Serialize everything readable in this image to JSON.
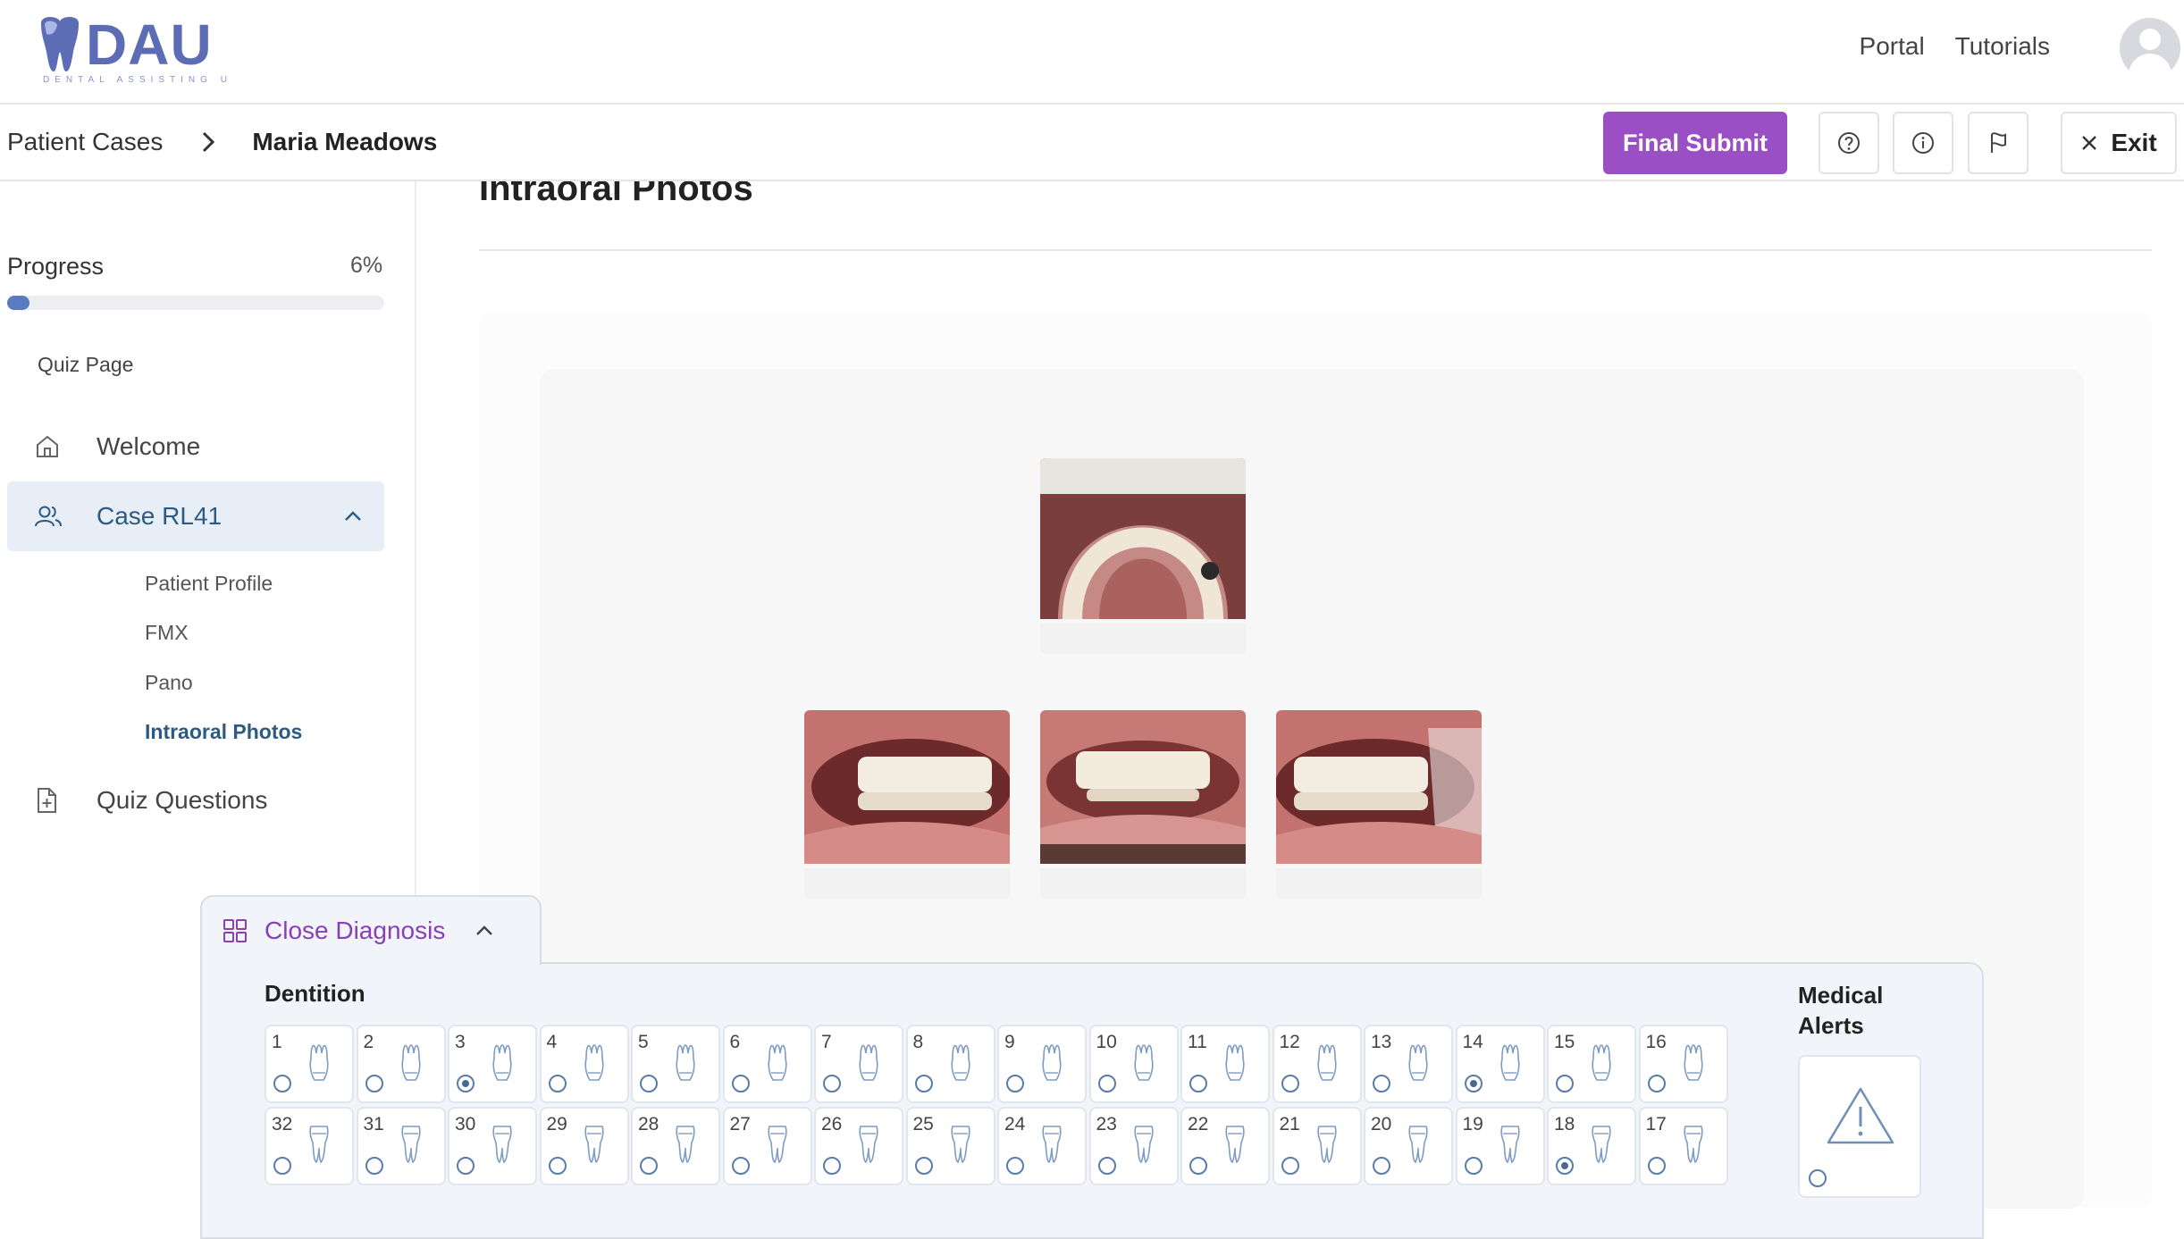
{
  "app": {
    "logo_text": "DAU",
    "logo_subtitle": "DENTAL ASSISTING U"
  },
  "topnav": {
    "portal": "Portal",
    "tutorials": "Tutorials"
  },
  "breadcrumb": {
    "root": "Patient Cases",
    "current": "Maria Meadows"
  },
  "toolbar": {
    "final_submit": "Final Submit",
    "exit": "Exit"
  },
  "sidebar": {
    "progress_label": "Progress",
    "progress_value": "6%",
    "progress_fraction": 0.06,
    "section_label": "Quiz Page",
    "items": [
      {
        "label": "Welcome",
        "icon": "home-icon"
      },
      {
        "label": "Case RL41",
        "icon": "users-icon",
        "expanded": true
      },
      {
        "label": "Quiz Questions",
        "icon": "file-plus-icon"
      }
    ],
    "sub_items": [
      {
        "label": "Patient Profile"
      },
      {
        "label": "FMX"
      },
      {
        "label": "Pano"
      },
      {
        "label": "Intraoral Photos",
        "active": true
      }
    ]
  },
  "main": {
    "title": "Intraoral Photos"
  },
  "diagnosis": {
    "toggle_label": "Close Diagnosis",
    "dentition_title": "Dentition",
    "medical_alerts_title": "Medical Alerts",
    "upper_teeth": [
      {
        "n": "1",
        "selected": false
      },
      {
        "n": "2",
        "selected": false
      },
      {
        "n": "3",
        "selected": true
      },
      {
        "n": "4",
        "selected": false
      },
      {
        "n": "5",
        "selected": false
      },
      {
        "n": "6",
        "selected": false
      },
      {
        "n": "7",
        "selected": false
      },
      {
        "n": "8",
        "selected": false
      },
      {
        "n": "9",
        "selected": false
      },
      {
        "n": "10",
        "selected": false
      },
      {
        "n": "11",
        "selected": false
      },
      {
        "n": "12",
        "selected": false
      },
      {
        "n": "13",
        "selected": false
      },
      {
        "n": "14",
        "selected": true
      },
      {
        "n": "15",
        "selected": false
      },
      {
        "n": "16",
        "selected": false
      }
    ],
    "lower_teeth": [
      {
        "n": "32",
        "selected": false
      },
      {
        "n": "31",
        "selected": false
      },
      {
        "n": "30",
        "selected": false
      },
      {
        "n": "29",
        "selected": false
      },
      {
        "n": "28",
        "selected": false
      },
      {
        "n": "27",
        "selected": false
      },
      {
        "n": "26",
        "selected": false
      },
      {
        "n": "25",
        "selected": false
      },
      {
        "n": "24",
        "selected": false
      },
      {
        "n": "23",
        "selected": false
      },
      {
        "n": "22",
        "selected": false
      },
      {
        "n": "21",
        "selected": false
      },
      {
        "n": "20",
        "selected": false
      },
      {
        "n": "19",
        "selected": false
      },
      {
        "n": "18",
        "selected": true
      },
      {
        "n": "17",
        "selected": false
      }
    ]
  },
  "colors": {
    "accent": "#9b4fc4",
    "brand": "#5c6db5",
    "active_nav": "#2c5a83",
    "progress": "#5b7bc1"
  }
}
